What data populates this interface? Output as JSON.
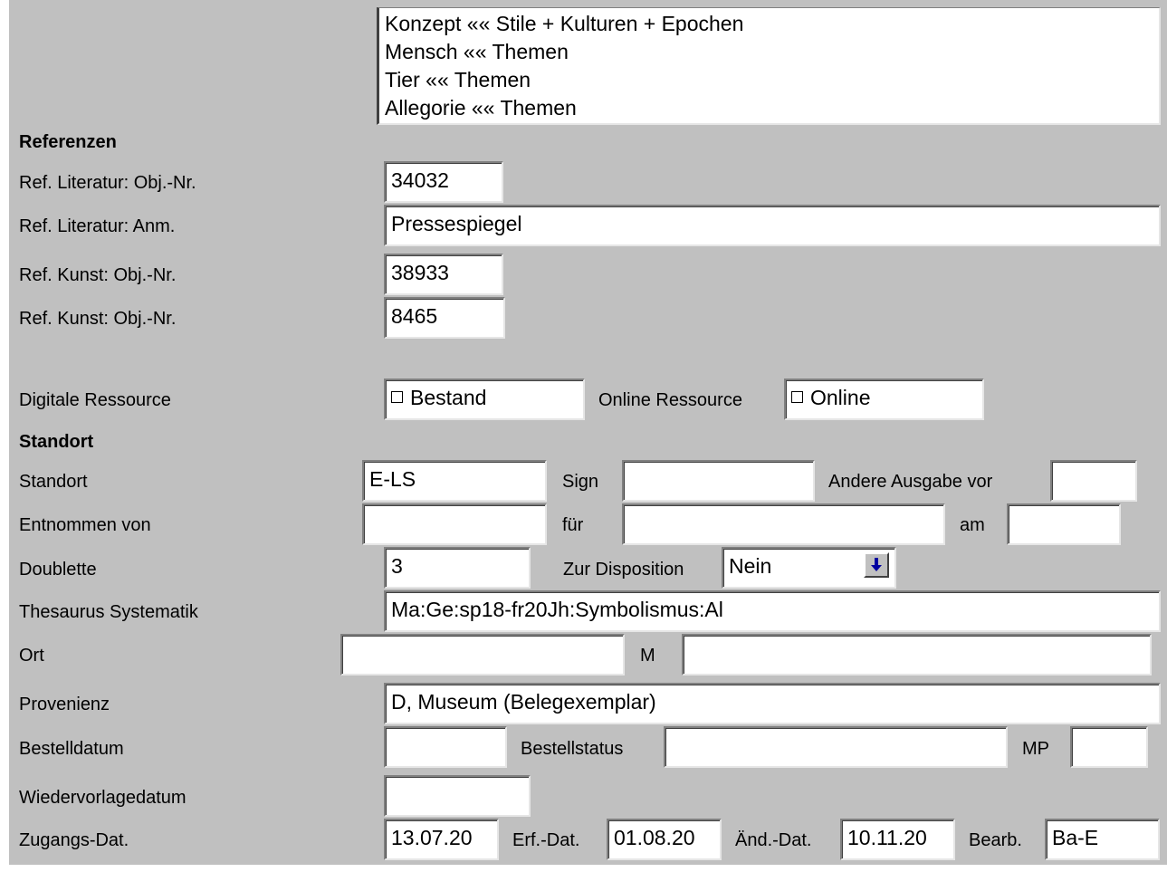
{
  "list": {
    "items": [
      "Konzept «« Stile + Kulturen + Epochen",
      "Mensch «« Themen",
      "Tier «« Themen",
      "Allegorie «« Themen"
    ]
  },
  "sections": {
    "referenzen": "Referenzen",
    "standort": "Standort"
  },
  "labels": {
    "ref_lit_objnr": "Ref. Literatur: Obj.-Nr.",
    "ref_lit_anm": "Ref. Literatur: Anm.",
    "ref_kunst_objnr_1": "Ref. Kunst: Obj.-Nr.",
    "ref_kunst_objnr_2": "Ref. Kunst: Obj.-Nr.",
    "digitale_ressource": "Digitale Ressource",
    "online_ressource": "Online Ressource",
    "standort": "Standort",
    "sign": "Sign",
    "andere_ausgabe": "Andere Ausgabe vor",
    "entnommen_von": "Entnommen von",
    "fuer": "für",
    "am": "am",
    "doublette": "Doublette",
    "zur_disposition": "Zur Disposition",
    "thesaurus": "Thesaurus Systematik",
    "ort": "Ort",
    "m": "M",
    "provenienz": "Provenienz",
    "bestelldatum": "Bestelldatum",
    "bestellstatus": "Bestellstatus",
    "mp": "MP",
    "wiedervorlagedatum": "Wiedervorlagedatum",
    "zugangs_dat": "Zugangs-Dat.",
    "erf_dat": "Erf.-Dat.",
    "aend_dat": "Änd.-Dat.",
    "bearb": "Bearb."
  },
  "values": {
    "ref_lit_objnr": "34032",
    "ref_lit_anm": "Pressespiegel",
    "ref_kunst_objnr_1": "38933",
    "ref_kunst_objnr_2": "8465",
    "bestand": "Bestand",
    "online": "Online",
    "standort": "E-LS",
    "sign": "",
    "andere_ausgabe": "",
    "entnommen_von": "",
    "fuer": "",
    "am": "",
    "doublette": "3",
    "zur_disposition": "Nein",
    "thesaurus": "Ma:Ge:sp18-fr20Jh:Symbolismus:Al",
    "ort": "",
    "m": "",
    "provenienz": "D, Museum (Belegexemplar)",
    "bestelldatum": "",
    "bestellstatus": "",
    "mp": "",
    "wiedervorlagedatum": "",
    "zugangs_dat": "13.07.20",
    "erf_dat": "01.08.20",
    "aend_dat": "10.11.20",
    "bearb": "Ba-E"
  },
  "icons": {
    "select_arrow": "arrow-down-icon"
  },
  "colors": {
    "panel_bg": "#c0c0c0",
    "field_bg": "#ffffff",
    "arrow": "#0000a0"
  }
}
